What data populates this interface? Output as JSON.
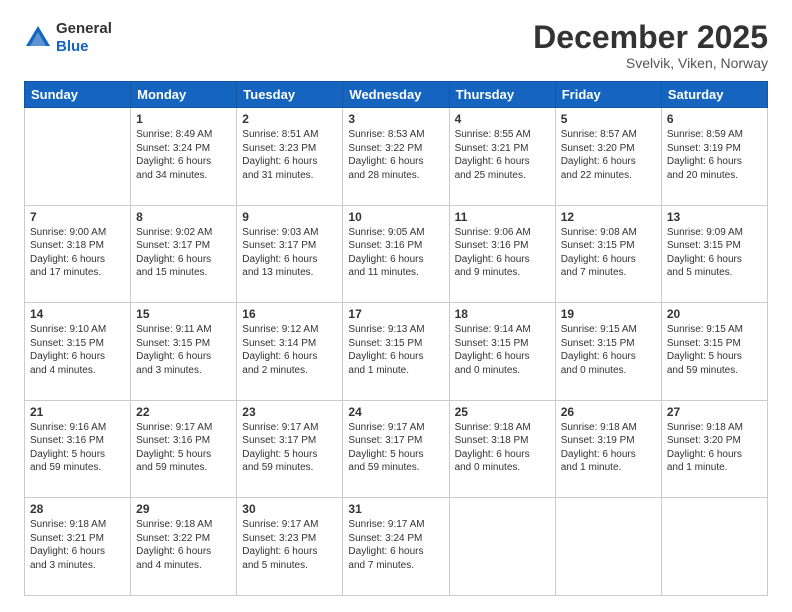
{
  "header": {
    "logo_general": "General",
    "logo_blue": "Blue",
    "month": "December 2025",
    "location": "Svelvik, Viken, Norway"
  },
  "days_of_week": [
    "Sunday",
    "Monday",
    "Tuesday",
    "Wednesday",
    "Thursday",
    "Friday",
    "Saturday"
  ],
  "weeks": [
    [
      {
        "day": "",
        "info": ""
      },
      {
        "day": "1",
        "info": "Sunrise: 8:49 AM\nSunset: 3:24 PM\nDaylight: 6 hours\nand 34 minutes."
      },
      {
        "day": "2",
        "info": "Sunrise: 8:51 AM\nSunset: 3:23 PM\nDaylight: 6 hours\nand 31 minutes."
      },
      {
        "day": "3",
        "info": "Sunrise: 8:53 AM\nSunset: 3:22 PM\nDaylight: 6 hours\nand 28 minutes."
      },
      {
        "day": "4",
        "info": "Sunrise: 8:55 AM\nSunset: 3:21 PM\nDaylight: 6 hours\nand 25 minutes."
      },
      {
        "day": "5",
        "info": "Sunrise: 8:57 AM\nSunset: 3:20 PM\nDaylight: 6 hours\nand 22 minutes."
      },
      {
        "day": "6",
        "info": "Sunrise: 8:59 AM\nSunset: 3:19 PM\nDaylight: 6 hours\nand 20 minutes."
      }
    ],
    [
      {
        "day": "7",
        "info": "Sunrise: 9:00 AM\nSunset: 3:18 PM\nDaylight: 6 hours\nand 17 minutes."
      },
      {
        "day": "8",
        "info": "Sunrise: 9:02 AM\nSunset: 3:17 PM\nDaylight: 6 hours\nand 15 minutes."
      },
      {
        "day": "9",
        "info": "Sunrise: 9:03 AM\nSunset: 3:17 PM\nDaylight: 6 hours\nand 13 minutes."
      },
      {
        "day": "10",
        "info": "Sunrise: 9:05 AM\nSunset: 3:16 PM\nDaylight: 6 hours\nand 11 minutes."
      },
      {
        "day": "11",
        "info": "Sunrise: 9:06 AM\nSunset: 3:16 PM\nDaylight: 6 hours\nand 9 minutes."
      },
      {
        "day": "12",
        "info": "Sunrise: 9:08 AM\nSunset: 3:15 PM\nDaylight: 6 hours\nand 7 minutes."
      },
      {
        "day": "13",
        "info": "Sunrise: 9:09 AM\nSunset: 3:15 PM\nDaylight: 6 hours\nand 5 minutes."
      }
    ],
    [
      {
        "day": "14",
        "info": "Sunrise: 9:10 AM\nSunset: 3:15 PM\nDaylight: 6 hours\nand 4 minutes."
      },
      {
        "day": "15",
        "info": "Sunrise: 9:11 AM\nSunset: 3:15 PM\nDaylight: 6 hours\nand 3 minutes."
      },
      {
        "day": "16",
        "info": "Sunrise: 9:12 AM\nSunset: 3:14 PM\nDaylight: 6 hours\nand 2 minutes."
      },
      {
        "day": "17",
        "info": "Sunrise: 9:13 AM\nSunset: 3:15 PM\nDaylight: 6 hours\nand 1 minute."
      },
      {
        "day": "18",
        "info": "Sunrise: 9:14 AM\nSunset: 3:15 PM\nDaylight: 6 hours\nand 0 minutes."
      },
      {
        "day": "19",
        "info": "Sunrise: 9:15 AM\nSunset: 3:15 PM\nDaylight: 6 hours\nand 0 minutes."
      },
      {
        "day": "20",
        "info": "Sunrise: 9:15 AM\nSunset: 3:15 PM\nDaylight: 5 hours\nand 59 minutes."
      }
    ],
    [
      {
        "day": "21",
        "info": "Sunrise: 9:16 AM\nSunset: 3:16 PM\nDaylight: 5 hours\nand 59 minutes."
      },
      {
        "day": "22",
        "info": "Sunrise: 9:17 AM\nSunset: 3:16 PM\nDaylight: 5 hours\nand 59 minutes."
      },
      {
        "day": "23",
        "info": "Sunrise: 9:17 AM\nSunset: 3:17 PM\nDaylight: 5 hours\nand 59 minutes."
      },
      {
        "day": "24",
        "info": "Sunrise: 9:17 AM\nSunset: 3:17 PM\nDaylight: 5 hours\nand 59 minutes."
      },
      {
        "day": "25",
        "info": "Sunrise: 9:18 AM\nSunset: 3:18 PM\nDaylight: 6 hours\nand 0 minutes."
      },
      {
        "day": "26",
        "info": "Sunrise: 9:18 AM\nSunset: 3:19 PM\nDaylight: 6 hours\nand 1 minute."
      },
      {
        "day": "27",
        "info": "Sunrise: 9:18 AM\nSunset: 3:20 PM\nDaylight: 6 hours\nand 1 minute."
      }
    ],
    [
      {
        "day": "28",
        "info": "Sunrise: 9:18 AM\nSunset: 3:21 PM\nDaylight: 6 hours\nand 3 minutes."
      },
      {
        "day": "29",
        "info": "Sunrise: 9:18 AM\nSunset: 3:22 PM\nDaylight: 6 hours\nand 4 minutes."
      },
      {
        "day": "30",
        "info": "Sunrise: 9:17 AM\nSunset: 3:23 PM\nDaylight: 6 hours\nand 5 minutes."
      },
      {
        "day": "31",
        "info": "Sunrise: 9:17 AM\nSunset: 3:24 PM\nDaylight: 6 hours\nand 7 minutes."
      },
      {
        "day": "",
        "info": ""
      },
      {
        "day": "",
        "info": ""
      },
      {
        "day": "",
        "info": ""
      }
    ]
  ]
}
